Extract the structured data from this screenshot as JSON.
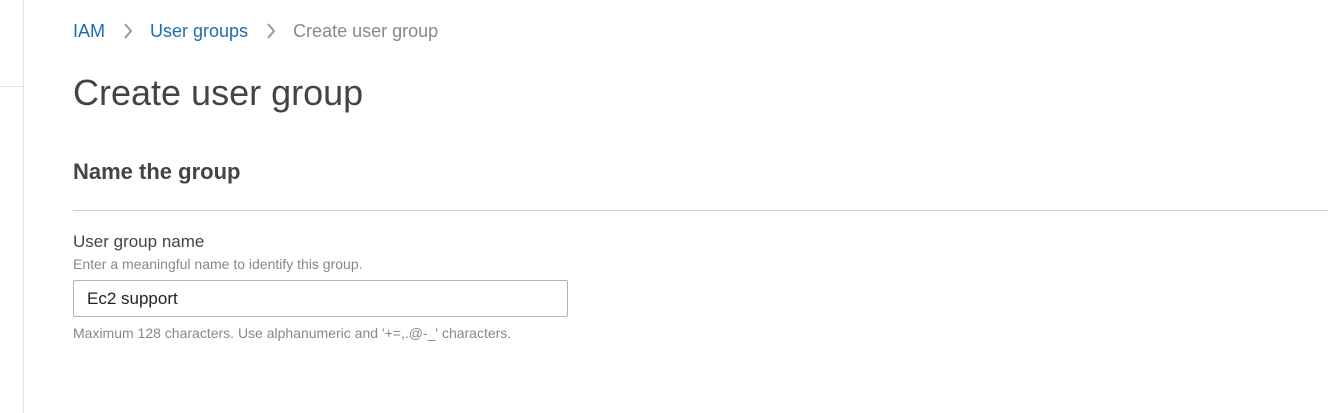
{
  "breadcrumb": {
    "items": [
      {
        "label": "IAM"
      },
      {
        "label": "User groups"
      },
      {
        "label": "Create user group"
      }
    ]
  },
  "page": {
    "title": "Create user group"
  },
  "section": {
    "title": "Name the group"
  },
  "group_name_field": {
    "label": "User group name",
    "description": "Enter a meaningful name to identify this group.",
    "value": "Ec2 support",
    "constraint": "Maximum 128 characters. Use alphanumeric and '+=,.@-_' characters."
  },
  "colors": {
    "link": "#1f6bb0",
    "muted_text": "#888888",
    "body_text": "#444444",
    "divider": "#c9c9c9",
    "input_border": "#aab7b8"
  },
  "icons": {
    "breadcrumb_separator": "chevron-right-icon"
  }
}
